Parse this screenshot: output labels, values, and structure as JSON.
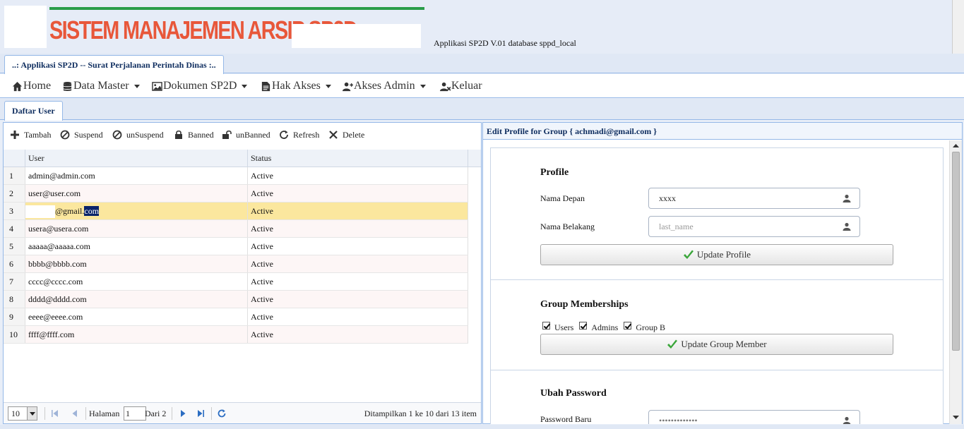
{
  "header": {
    "title": "SISTEM MANAJEMEN ARSIP SP2D",
    "info": "Applikasi SP2D V.01 database sppd_local"
  },
  "app_tab": {
    "label": "..: Applikasi SP2D -- Surat Perjalanan Perintah Dinas :.."
  },
  "menu": {
    "items": [
      {
        "label": "Home",
        "icon": "home-icon",
        "dropdown": false
      },
      {
        "label": "Data Master",
        "icon": "database-icon",
        "dropdown": true
      },
      {
        "label": "Dokumen SP2D",
        "icon": "image-icon",
        "dropdown": true
      },
      {
        "label": "Hak Akses",
        "icon": "document-icon",
        "dropdown": true
      },
      {
        "label": "Akses Admin",
        "icon": "user-add-icon",
        "dropdown": true
      },
      {
        "label": "Keluar",
        "icon": "user-remove-icon",
        "dropdown": false
      }
    ]
  },
  "sub_tab": {
    "label": "Daftar User"
  },
  "toolbar": {
    "tambah": "Tambah",
    "suspend": "Suspend",
    "unsuspend": "unSuspend",
    "banned": "Banned",
    "unbanned": "unBanned",
    "refresh": "Refresh",
    "delete": "Delete"
  },
  "grid": {
    "columns": {
      "user": "User",
      "status": "Status"
    },
    "rows": [
      {
        "num": "1",
        "user": "admin@admin.com",
        "status": "Active"
      },
      {
        "num": "2",
        "user": "user@user.com",
        "status": "Active"
      },
      {
        "num": "3",
        "user_visible_prefix": "@gmail.",
        "user_highlight": "com",
        "status": "Active"
      },
      {
        "num": "4",
        "user": "usera@usera.com",
        "status": "Active"
      },
      {
        "num": "5",
        "user": "aaaaa@aaaaa.com",
        "status": "Active"
      },
      {
        "num": "6",
        "user": "bbbb@bbbb.com",
        "status": "Active"
      },
      {
        "num": "7",
        "user": "cccc@cccc.com",
        "status": "Active"
      },
      {
        "num": "8",
        "user": "dddd@dddd.com",
        "status": "Active"
      },
      {
        "num": "9",
        "user": "eeee@eeee.com",
        "status": "Active"
      },
      {
        "num": "10",
        "user": "ffff@ffff.com",
        "status": "Active"
      }
    ]
  },
  "pager": {
    "page_size": "10",
    "halaman_label": "Halaman",
    "page": "1",
    "dari_label": "Dari 2",
    "info": "Ditampilkan 1 ke 10 dari 13 item"
  },
  "edit": {
    "title": "Edit Profile for Group { achmadi@gmail.com }",
    "profile": {
      "heading": "Profile",
      "first_name_label": "Nama Depan",
      "first_name_value": "xxxx",
      "last_name_label": "Nama Belakang",
      "last_name_placeholder": "last_name",
      "update_button": "Update Profile"
    },
    "groups": {
      "heading": "Group Memberships",
      "options": [
        "Users",
        "Admins",
        "Group B"
      ],
      "update_button": "Update Group Member"
    },
    "password": {
      "heading": "Ubah Password",
      "new_label": "Password Baru",
      "new_value": "•••••••••••••"
    }
  },
  "colors": {
    "title_accent": "#e8573a",
    "title_line": "#2a9d4a",
    "border": "#95b8e7",
    "selected_row": "#fbe79e"
  }
}
